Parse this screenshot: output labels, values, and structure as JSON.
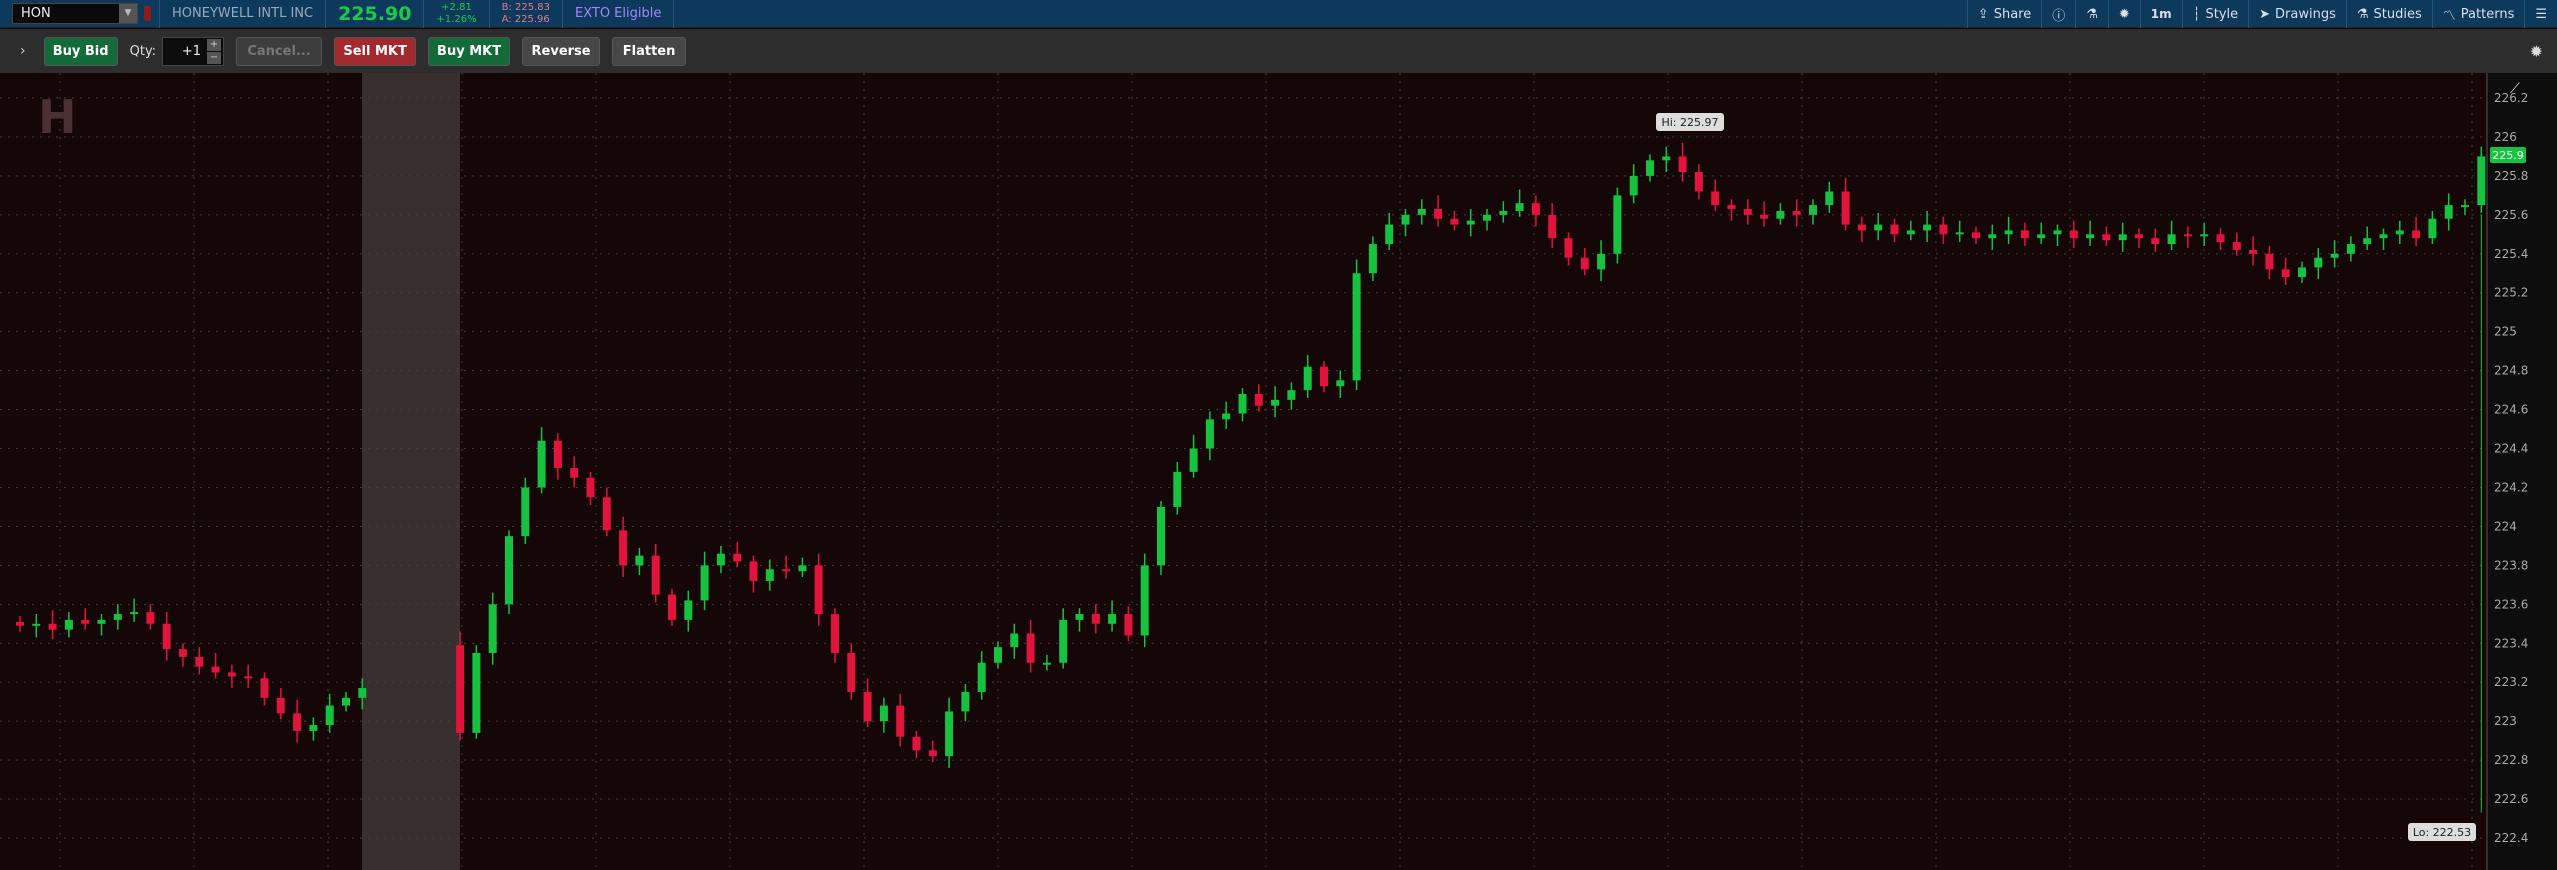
{
  "header": {
    "symbol": "HON",
    "company": "HONEYWELL INTL INC",
    "last": "225.90",
    "change": "+2.81",
    "change_pct": "+1.26%",
    "bid": "B: 225.83",
    "ask": "A: 225.96",
    "exto": "EXTO Eligible"
  },
  "menu": {
    "share": "Share",
    "interval": "1m",
    "style": "Style",
    "drawings": "Drawings",
    "studies": "Studies",
    "patterns": "Patterns"
  },
  "toolbar": {
    "buy_bid": "Buy Bid",
    "qty_label": "Qty:",
    "qty_value": "+1",
    "cancel": "Cancel...",
    "sell_mkt": "Sell MKT",
    "buy_mkt": "Buy MKT",
    "reverse": "Reverse",
    "flatten": "Flatten"
  },
  "colors": {
    "up": "#17c23e",
    "down": "#e0143c",
    "bg": "#150607",
    "accent": "#0d3a5c"
  },
  "chart_data": {
    "type": "candlestick",
    "ylim": [
      222.4,
      226.2
    ],
    "yticks": [
      "226.2",
      "226",
      "225.8",
      "225.6",
      "225.4",
      "225.2",
      "225",
      "224.8",
      "224.6",
      "224.4",
      "224.2",
      "224",
      "223.8",
      "223.6",
      "223.4",
      "223.2",
      "223",
      "222.8",
      "222.6",
      "222.4"
    ],
    "hi_label": "Hi: 225.97",
    "lo_label": "Lo: 222.53",
    "last_tag": "225.9",
    "closes": [
      223.49,
      223.5,
      223.47,
      223.52,
      223.5,
      223.52,
      223.55,
      223.56,
      223.5,
      223.37,
      223.33,
      223.28,
      223.25,
      223.23,
      223.22,
      223.12,
      223.04,
      222.95,
      222.98,
      223.08,
      223.12,
      223.17,
      null,
      null,
      null,
      null,
      null,
      222.94,
      223.35,
      223.6,
      223.95,
      224.2,
      224.44,
      224.3,
      224.25,
      224.15,
      223.98,
      223.8,
      223.85,
      223.65,
      223.52,
      223.62,
      223.8,
      223.86,
      223.82,
      223.72,
      223.78,
      223.77,
      223.8,
      223.55,
      223.35,
      223.15,
      223.0,
      223.08,
      222.92,
      222.85,
      222.82,
      223.05,
      223.15,
      223.3,
      223.38,
      223.45,
      223.3,
      223.3,
      223.52,
      223.55,
      223.5,
      223.55,
      223.44,
      223.8,
      224.1,
      224.28,
      224.4,
      224.55,
      224.58,
      224.68,
      224.62,
      224.65,
      224.7,
      224.82,
      224.72,
      224.75,
      225.3,
      225.45,
      225.55,
      225.6,
      225.63,
      225.58,
      225.55,
      225.57,
      225.6,
      225.62,
      225.66,
      225.6,
      225.48,
      225.38,
      225.32,
      225.4,
      225.7,
      225.8,
      225.88,
      225.9,
      225.82,
      225.72,
      225.65,
      225.63,
      225.6,
      225.58,
      225.62,
      225.6,
      225.65,
      225.72,
      225.55,
      225.52,
      225.55,
      225.5,
      225.52,
      225.55,
      225.5,
      225.51,
      225.48,
      225.5,
      225.52,
      225.48,
      225.5,
      225.52,
      225.48,
      225.5,
      225.47,
      225.5,
      225.48,
      225.45,
      225.5,
      225.49,
      225.5,
      225.46,
      225.42,
      225.4,
      225.32,
      225.28,
      225.33,
      225.38,
      225.4,
      225.45,
      225.48,
      225.5,
      225.52,
      225.48,
      225.58,
      225.65,
      225.65,
      225.9
    ]
  }
}
